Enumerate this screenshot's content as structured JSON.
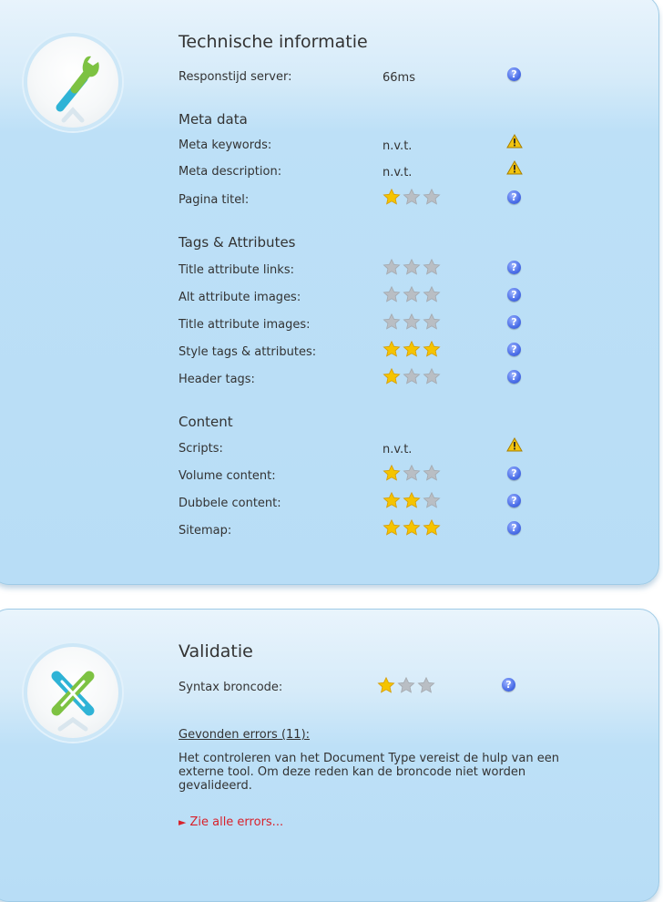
{
  "technical": {
    "title": "Technische informatie",
    "logo_icon": "wrench-icon",
    "rows": [
      {
        "label": "Responstijd server:",
        "value": "66ms",
        "rating": null,
        "info": "help"
      }
    ],
    "groups": [
      {
        "title": "Meta data",
        "rows": [
          {
            "label": "Meta keywords:",
            "value": "n.v.t.",
            "rating": null,
            "info": "warning"
          },
          {
            "label": "Meta description:",
            "value": "n.v.t.",
            "rating": null,
            "info": "warning"
          },
          {
            "label": "Pagina titel:",
            "value": null,
            "rating": 1,
            "info": "help"
          }
        ]
      },
      {
        "title": "Tags & Attributes",
        "rows": [
          {
            "label": "Title attribute links:",
            "value": null,
            "rating": 0,
            "info": "help"
          },
          {
            "label": "Alt attribute images:",
            "value": null,
            "rating": 0,
            "info": "help"
          },
          {
            "label": "Title attribute images:",
            "value": null,
            "rating": 0,
            "info": "help"
          },
          {
            "label": "Style tags & attributes:",
            "value": null,
            "rating": 3,
            "info": "help"
          },
          {
            "label": "Header tags:",
            "value": null,
            "rating": 1,
            "info": "help"
          }
        ]
      },
      {
        "title": "Content",
        "rows": [
          {
            "label": "Scripts:",
            "value": "n.v.t.",
            "rating": null,
            "info": "warning"
          },
          {
            "label": "Volume content:",
            "value": null,
            "rating": 1,
            "info": "help"
          },
          {
            "label": "Dubbele content:",
            "value": null,
            "rating": 2,
            "info": "help"
          },
          {
            "label": "Sitemap:",
            "value": null,
            "rating": 3,
            "info": "help"
          }
        ]
      }
    ]
  },
  "validation": {
    "title": "Validatie",
    "logo_icon": "x-mark-icon",
    "syntax_label": "Syntax broncode:",
    "syntax_rating": 1,
    "errors_heading": "Gevonden errors (11):",
    "errors_text": "Het controleren van het Document Type vereist de hulp van een externe tool. Om deze reden kan de broncode niet worden gevalideerd.",
    "errors_link": "Zie alle errors...",
    "errors_link_arrow": "►"
  },
  "rating_max": 3,
  "help_glyph": "?",
  "colors": {
    "star_on": "#f5c400",
    "star_off": "#b9bec4",
    "link": "#d8212b",
    "help": "#4b6ee8"
  }
}
